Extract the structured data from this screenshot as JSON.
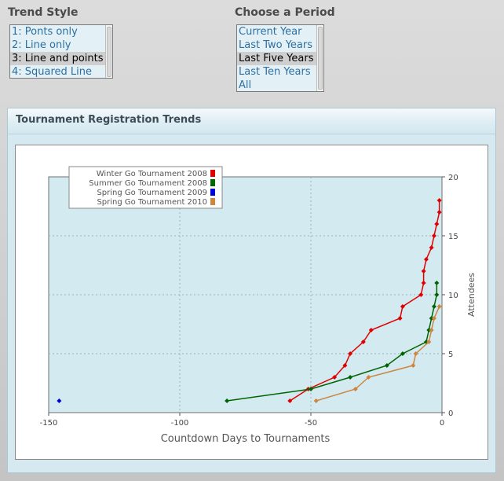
{
  "trend_style": {
    "title": "Trend Style",
    "options": [
      "1: Ponts only",
      "2: Line only",
      "3: Line and points",
      "4: Squared Line"
    ],
    "selected": "3: Line and points"
  },
  "period": {
    "title": "Choose a Period",
    "options": [
      "Current Year",
      "Last Two Years",
      "Last Five Years",
      "Last Ten Years",
      "All"
    ],
    "selected": "Last Five Years"
  },
  "panel": {
    "title": "Tournament Registration Trends"
  },
  "colors": {
    "winter": "#e00000",
    "summer": "#006400",
    "spring2009": "#0000dd",
    "spring2010": "#cd853f",
    "plot_bg": "#d3eaf1"
  },
  "chart_data": {
    "type": "line",
    "xlabel": "Countdown Days to Tournaments",
    "ylabel": "Attendees",
    "xlim": [
      -150,
      0
    ],
    "ylim": [
      0,
      20
    ],
    "xticks": [
      -150,
      -100,
      -50,
      0
    ],
    "yticks": [
      0,
      5,
      10,
      15,
      20
    ],
    "grid": true,
    "y_axis_side": "right",
    "legend_position": "top-left",
    "series": [
      {
        "name": "Winter Go Tournament 2008",
        "color": "#e00000",
        "points": [
          [
            -58,
            1
          ],
          [
            -51,
            2
          ],
          [
            -41,
            3
          ],
          [
            -37,
            4
          ],
          [
            -35,
            5
          ],
          [
            -30,
            6
          ],
          [
            -27,
            7
          ],
          [
            -16,
            8
          ],
          [
            -15,
            9
          ],
          [
            -8,
            10
          ],
          [
            -7,
            11
          ],
          [
            -7,
            12
          ],
          [
            -6,
            13
          ],
          [
            -4,
            14
          ],
          [
            -3,
            15
          ],
          [
            -2,
            16
          ],
          [
            -1,
            17
          ],
          [
            -1,
            18
          ]
        ]
      },
      {
        "name": "Summer Go Tournament 2008",
        "color": "#006400",
        "points": [
          [
            -82,
            1
          ],
          [
            -50,
            2
          ],
          [
            -35,
            3
          ],
          [
            -21,
            4
          ],
          [
            -15,
            5
          ],
          [
            -6,
            6
          ],
          [
            -5,
            7
          ],
          [
            -4,
            8
          ],
          [
            -3,
            9
          ],
          [
            -2,
            10
          ],
          [
            -2,
            11
          ]
        ]
      },
      {
        "name": "Spring Go Tournament 2009",
        "color": "#0000dd",
        "points": [
          [
            -146,
            1
          ]
        ]
      },
      {
        "name": "Spring Go Tournament 2010",
        "color": "#cd853f",
        "points": [
          [
            -48,
            1
          ],
          [
            -33,
            2
          ],
          [
            -28,
            3
          ],
          [
            -11,
            4
          ],
          [
            -10,
            5
          ],
          [
            -5,
            6
          ],
          [
            -4,
            7
          ],
          [
            -3,
            8
          ],
          [
            -1,
            9
          ]
        ]
      }
    ]
  }
}
